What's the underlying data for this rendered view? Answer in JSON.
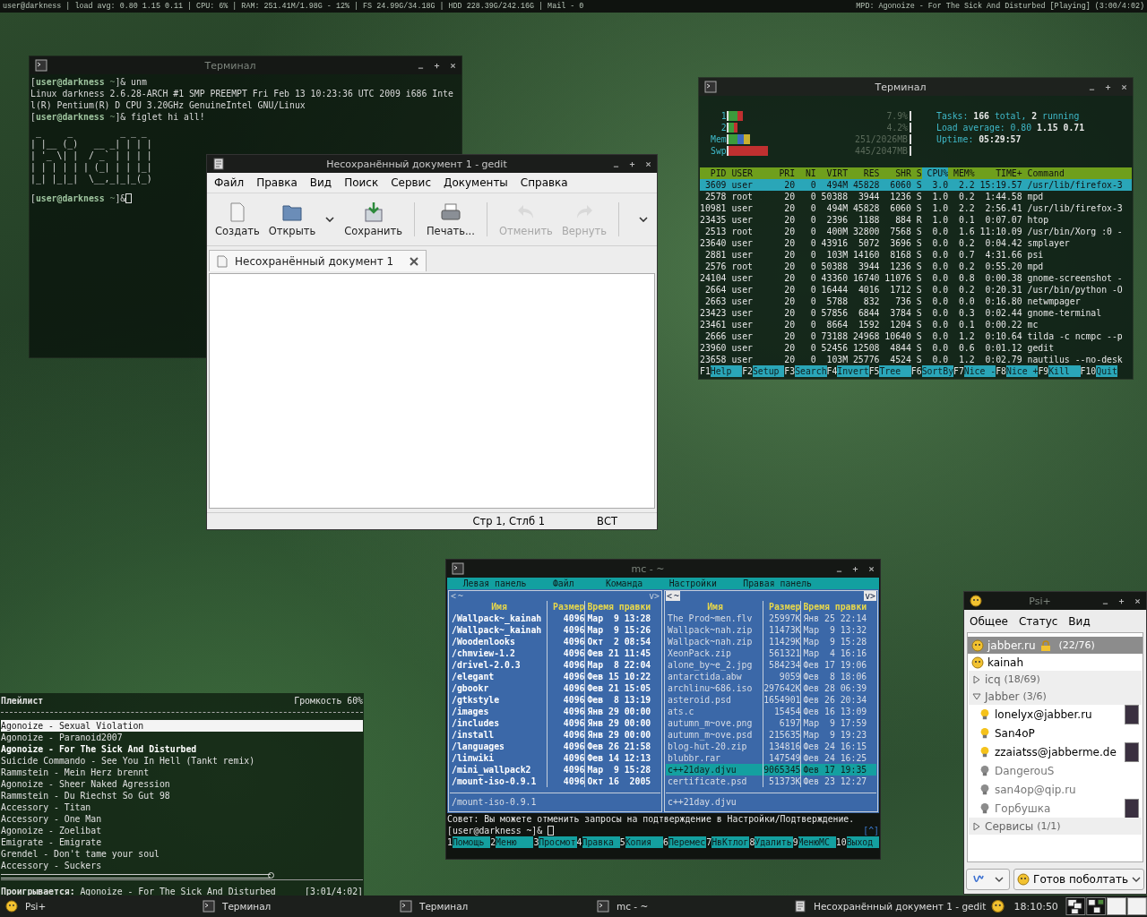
{
  "top_bar": {
    "left": "user@darkness | load avg: 0.80 1.15 0.11 | CPU: 6% | RAM: 251.41M/1.98G - 12% | FS 24.99G/34.18G | HDD 228.39G/242.16G | Mail - 0",
    "right": "MPD: Agonoize - For The Sick And Disturbed [Playing] (3:00/4:02)"
  },
  "gedit": {
    "title": "Несохранённый документ 1 - gedit",
    "menu": [
      "Файл",
      "Правка",
      "Вид",
      "Поиск",
      "Сервис",
      "Документы",
      "Справка"
    ],
    "toolbar": [
      {
        "kind": "button",
        "label": "Создать",
        "disabled": false
      },
      {
        "kind": "button",
        "label": "Открыть",
        "disabled": false
      },
      {
        "kind": "dropdown"
      },
      {
        "kind": "button",
        "label": "Сохранить",
        "disabled": false
      },
      {
        "kind": "separator"
      },
      {
        "kind": "button",
        "label": "Печать...",
        "disabled": false
      },
      {
        "kind": "separator"
      },
      {
        "kind": "button",
        "label": "Отменить",
        "disabled": true
      },
      {
        "kind": "button",
        "label": "Вернуть",
        "disabled": true
      },
      {
        "kind": "separator"
      },
      {
        "kind": "overflow"
      }
    ],
    "tabs": [
      {
        "label": "Несохранённый документ 1",
        "selected": true
      }
    ],
    "status": {
      "position": "Стр 1, Стлб 1",
      "mode": "ВСТ"
    }
  },
  "terminal": {
    "title": "Терминал",
    "lines": [
      {
        "kind": "prompt",
        "cursor": false,
        "segments": [
          "[",
          "user@darkness",
          " ~",
          "]& unm"
        ]
      },
      {
        "kind": "output",
        "text": "Linux darkness 2.6.28-ARCH #1 SMP PREEMPT Fri Feb 13 10:23:36 UTC 2009 i686 Inte"
      },
      {
        "kind": "output",
        "text": "l(R) Pentium(R) D CPU 3.20GHz GenuineIntel GNU/Linux"
      },
      {
        "kind": "prompt",
        "cursor": false,
        "segments": [
          "[",
          "user@darkness",
          " ~",
          "]& figlet hi all!"
        ]
      },
      {
        "kind": "art",
        "lines": [
          " _     _         _ _ _ ",
          "| |__ (_)   __ _| | | |",
          "| '_ \\| |  / _` | | | |",
          "| | | | | | (_| | | |_|",
          "|_| |_|_|  \\__,_|_|_(_)"
        ]
      },
      {
        "kind": "prompt",
        "cursor": true,
        "segments": [
          "[",
          "user@darkness",
          " ~",
          "]&"
        ]
      }
    ]
  },
  "htop": {
    "title": "Терминал",
    "meters": [
      {
        "kind": "cpu",
        "label": "1",
        "level": 0.08,
        "reading": "7.9%"
      },
      {
        "kind": "cpu",
        "label": "2",
        "level": 0.05,
        "reading": "4.2%"
      },
      {
        "kind": "mem",
        "label": "Mem",
        "level": 0.12,
        "reading": "251/2026MB"
      },
      {
        "kind": "swap",
        "label": "Swp",
        "level": 0.22,
        "reading": "445/2047MB"
      }
    ],
    "info": [
      "Tasks: **166** total, **2** running",
      "Load average: 0.80 **1.15** **0.71**",
      "Uptime: **05:29:57**"
    ],
    "columns": [
      {
        "label": "PID",
        "sorted": false
      },
      {
        "label": "USER",
        "sorted": false
      },
      {
        "label": "PRI",
        "sorted": false
      },
      {
        "label": "NI",
        "sorted": false
      },
      {
        "label": "VIRT",
        "sorted": false
      },
      {
        "label": "RES",
        "sorted": false
      },
      {
        "label": "SHR",
        "sorted": false
      },
      {
        "label": "S",
        "sorted": false
      },
      {
        "label": "CPU%",
        "sorted": true
      },
      {
        "label": "MEM%",
        "sorted": false
      },
      {
        "label": "TIME+",
        "sorted": false
      },
      {
        "label": "Command",
        "sorted": false
      }
    ],
    "rows": [
      {
        "selected": true,
        "cells": [
          "3609",
          "user",
          "20",
          "0",
          "494M",
          "45828",
          "6060",
          "S",
          "3.0",
          "2.2",
          "15:19.57",
          "/usr/lib/firefox-3"
        ]
      },
      {
        "selected": false,
        "cells": [
          "2578",
          "root",
          "20",
          "0",
          "50388",
          "3944",
          "1236",
          "S",
          "1.0",
          "0.2",
          "1:44.58",
          "mpd"
        ]
      },
      {
        "selected": false,
        "cells": [
          "10981",
          "user",
          "20",
          "0",
          "494M",
          "45828",
          "6060",
          "S",
          "1.0",
          "2.2",
          "2:56.41",
          "/usr/lib/firefox-3"
        ]
      },
      {
        "selected": false,
        "cells": [
          "23435",
          "user",
          "20",
          "0",
          "2396",
          "1188",
          "884",
          "R",
          "1.0",
          "0.1",
          "0:07.07",
          "htop"
        ]
      },
      {
        "selected": false,
        "cells": [
          "2513",
          "root",
          "20",
          "0",
          "400M",
          "32800",
          "7568",
          "S",
          "0.0",
          "1.6",
          "11:10.09",
          "/usr/bin/Xorg :0 -"
        ]
      },
      {
        "selected": false,
        "cells": [
          "23640",
          "user",
          "20",
          "0",
          "43916",
          "5072",
          "3696",
          "S",
          "0.0",
          "0.2",
          "0:04.42",
          "smplayer"
        ]
      },
      {
        "selected": false,
        "cells": [
          "2881",
          "user",
          "20",
          "0",
          "103M",
          "14160",
          "8168",
          "S",
          "0.0",
          "0.7",
          "4:31.66",
          "psi"
        ]
      },
      {
        "selected": false,
        "cells": [
          "2576",
          "root",
          "20",
          "0",
          "50388",
          "3944",
          "1236",
          "S",
          "0.0",
          "0.2",
          "0:55.20",
          "mpd"
        ]
      },
      {
        "selected": false,
        "cells": [
          "24104",
          "user",
          "20",
          "0",
          "43360",
          "16740",
          "11076",
          "S",
          "0.0",
          "0.8",
          "0:00.38",
          "gnome-screenshot -"
        ]
      },
      {
        "selected": false,
        "cells": [
          "2664",
          "user",
          "20",
          "0",
          "16444",
          "4016",
          "1712",
          "S",
          "0.0",
          "0.2",
          "0:20.31",
          "/usr/bin/python -O"
        ]
      },
      {
        "selected": false,
        "cells": [
          "2663",
          "user",
          "20",
          "0",
          "5788",
          "832",
          "736",
          "S",
          "0.0",
          "0.0",
          "0:16.80",
          "netwmpager"
        ]
      },
      {
        "selected": false,
        "cells": [
          "23423",
          "user",
          "20",
          "0",
          "57856",
          "6844",
          "3784",
          "S",
          "0.0",
          "0.3",
          "0:02.44",
          "gnome-terminal"
        ]
      },
      {
        "selected": false,
        "cells": [
          "23461",
          "user",
          "20",
          "0",
          "8664",
          "1592",
          "1204",
          "S",
          "0.0",
          "0.1",
          "0:00.22",
          "mc"
        ]
      },
      {
        "selected": false,
        "cells": [
          "2666",
          "user",
          "20",
          "0",
          "73188",
          "24968",
          "10640",
          "S",
          "0.0",
          "1.2",
          "0:10.64",
          "tilda -c ncmpc --p"
        ]
      },
      {
        "selected": false,
        "cells": [
          "23960",
          "user",
          "20",
          "0",
          "52456",
          "12508",
          "4844",
          "S",
          "0.0",
          "0.6",
          "0:01.12",
          "gedit"
        ]
      },
      {
        "selected": false,
        "cells": [
          "23658",
          "user",
          "20",
          "0",
          "103M",
          "25776",
          "4524",
          "S",
          "0.0",
          "1.2",
          "0:02.79",
          "nautilus --no-desk"
        ]
      }
    ],
    "keys": [
      {
        "key": "F1",
        "label": "Help"
      },
      {
        "key": "F2",
        "label": "Setup"
      },
      {
        "key": "F3",
        "label": "Search"
      },
      {
        "key": "F4",
        "label": "Invert"
      },
      {
        "key": "F5",
        "label": "Tree"
      },
      {
        "key": "F6",
        "label": "SortBy"
      },
      {
        "key": "F7",
        "label": "Nice -"
      },
      {
        "key": "F8",
        "label": "Nice +"
      },
      {
        "key": "F9",
        "label": "Kill"
      },
      {
        "key": "F10",
        "label": "Quit"
      }
    ]
  },
  "mc": {
    "title": "mc - ~",
    "menu": [
      "Левая панель",
      "Файл",
      "Команда",
      "Настройки",
      "Правая панель"
    ],
    "panels": [
      {
        "active": false,
        "corner_left": "<",
        "path": "~",
        "corner_right": "v>",
        "columns": [
          "Имя",
          "Размер",
          "Время правки"
        ],
        "status": "/mount-iso-0.9.1",
        "rows": [
          {
            "kind": "dir",
            "selected": false,
            "cells": [
              "/Wallpack~_kainah",
              "4096",
              "Мар  9 13:28"
            ]
          },
          {
            "kind": "dir",
            "selected": false,
            "cells": [
              "/Wallpack~_kainah",
              "4096",
              "Мар  9 15:26"
            ]
          },
          {
            "kind": "dir",
            "selected": false,
            "cells": [
              "/Woodenlooks",
              "4096",
              "Окт  2 08:54"
            ]
          },
          {
            "kind": "dir",
            "selected": false,
            "cells": [
              "/chmview-1.2",
              "4096",
              "Фев 21 11:45"
            ]
          },
          {
            "kind": "dir",
            "selected": false,
            "cells": [
              "/drivel-2.0.3",
              "4096",
              "Мар  8 22:04"
            ]
          },
          {
            "kind": "dir",
            "selected": false,
            "cells": [
              "/elegant",
              "4096",
              "Фев 15 10:22"
            ]
          },
          {
            "kind": "dir",
            "selected": false,
            "cells": [
              "/gbookr",
              "4096",
              "Фев 21 15:05"
            ]
          },
          {
            "kind": "dir",
            "selected": false,
            "cells": [
              "/gtkstyle",
              "4096",
              "Фев  8 13:19"
            ]
          },
          {
            "kind": "dir",
            "selected": false,
            "cells": [
              "/images",
              "4096",
              "Янв 29 00:00"
            ]
          },
          {
            "kind": "dir",
            "selected": false,
            "cells": [
              "/includes",
              "4096",
              "Янв 29 00:00"
            ]
          },
          {
            "kind": "dir",
            "selected": false,
            "cells": [
              "/install",
              "4096",
              "Янв 29 00:00"
            ]
          },
          {
            "kind": "dir",
            "selected": false,
            "cells": [
              "/languages",
              "4096",
              "Фев 26 21:58"
            ]
          },
          {
            "kind": "dir",
            "selected": false,
            "cells": [
              "/linwiki",
              "4096",
              "Фев 14 12:13"
            ]
          },
          {
            "kind": "dir",
            "selected": false,
            "cells": [
              "/mini_wallpack2",
              "4096",
              "Мар  9 15:28"
            ]
          },
          {
            "kind": "dir",
            "selected": false,
            "cells": [
              "/mount-iso-0.9.1",
              "4096",
              "Окт 16  2005"
            ]
          }
        ]
      },
      {
        "active": true,
        "corner_left": "<",
        "path": "~",
        "corner_right": "v>",
        "columns": [
          "Имя",
          "Размер",
          "Время правки"
        ],
        "status": "c++21day.djvu",
        "rows": [
          {
            "kind": "file",
            "selected": false,
            "cells": [
              "The Prod~men.flv",
              "25997K",
              "Янв 25 22:14"
            ]
          },
          {
            "kind": "file",
            "selected": false,
            "cells": [
              "Wallpack~nah.zip",
              "11473K",
              "Мар  9 13:32"
            ]
          },
          {
            "kind": "file",
            "selected": false,
            "cells": [
              "Wallpack~nah.zip",
              "11429K",
              "Мар  9 15:28"
            ]
          },
          {
            "kind": "file",
            "selected": false,
            "cells": [
              "XeonPack.zip",
              "561321",
              "Мар  4 16:16"
            ]
          },
          {
            "kind": "file",
            "selected": false,
            "cells": [
              "alone_by~e_2.jpg",
              "584234",
              "Фев 17 19:06"
            ]
          },
          {
            "kind": "file",
            "selected": false,
            "cells": [
              "antarctida.abw",
              "9059",
              "Фев  8 18:06"
            ]
          },
          {
            "kind": "file",
            "selected": false,
            "cells": [
              "archlinu~686.iso",
              "297642K",
              "Фев 28 06:39"
            ]
          },
          {
            "kind": "file",
            "selected": false,
            "cells": [
              "asteroid.psd",
              "1654901",
              "Фев 26 20:34"
            ]
          },
          {
            "kind": "file",
            "selected": false,
            "cells": [
              "ats.c",
              "15454",
              "Фев 16 13:09"
            ]
          },
          {
            "kind": "file",
            "selected": false,
            "cells": [
              "autumn_m~ove.png",
              "6197",
              "Мар  9 17:59"
            ]
          },
          {
            "kind": "file",
            "selected": false,
            "cells": [
              "autumn_m~ove.psd",
              "215635",
              "Мар  9 19:23"
            ]
          },
          {
            "kind": "file",
            "selected": false,
            "cells": [
              "blog-hut-20.zip",
              "134816",
              "Фев 24 16:15"
            ]
          },
          {
            "kind": "file",
            "selected": false,
            "cells": [
              "blubbr.rar",
              "147549",
              "Фев 24 16:25"
            ]
          },
          {
            "kind": "file",
            "selected": true,
            "cells": [
              "c++21day.djvu",
              "9065345",
              "Фев 17 19:35"
            ]
          },
          {
            "kind": "file",
            "selected": false,
            "cells": [
              "certificate.psd",
              "51373K",
              "Фев 23 12:27"
            ]
          }
        ]
      }
    ],
    "hint": "Совет: Вы можете отменить запросы на подтверждение в Настройки/Подтверждение.",
    "prompt": "[user@darkness ~]&",
    "scroll_marker": "[^]",
    "keys": [
      {
        "key": "1",
        "label": "Помощь"
      },
      {
        "key": "2",
        "label": "Меню"
      },
      {
        "key": "3",
        "label": "Просмот"
      },
      {
        "key": "4",
        "label": "Правка"
      },
      {
        "key": "5",
        "label": "Копия"
      },
      {
        "key": "6",
        "label": "Перемес"
      },
      {
        "key": "7",
        "label": "НвКтлог"
      },
      {
        "key": "8",
        "label": "Удалить"
      },
      {
        "key": "9",
        "label": "МенюМС"
      },
      {
        "key": "10",
        "label": "Выход"
      }
    ]
  },
  "playlist": {
    "title": "Плейлист",
    "volume": "Громкость 60%",
    "songs": [
      {
        "title": "Agonoize - Sexual Violation",
        "selected": true,
        "playing": false
      },
      {
        "title": "Agonoize - Paranoid2007",
        "selected": false,
        "playing": false
      },
      {
        "title": "Agonoize - For The Sick And Disturbed",
        "selected": false,
        "playing": true
      },
      {
        "title": "Suicide Commando - See You In Hell (Tankt remix)",
        "selected": false,
        "playing": false
      },
      {
        "title": "Rammstein - Mein Herz brennt",
        "selected": false,
        "playing": false
      },
      {
        "title": "Agonoize - Sheer Naked Agression",
        "selected": false,
        "playing": false
      },
      {
        "title": "Rammstein - Du Riechst So Gut 98",
        "selected": false,
        "playing": false
      },
      {
        "title": "Accessory - Titan",
        "selected": false,
        "playing": false
      },
      {
        "title": "Accessory - One Man",
        "selected": false,
        "playing": false
      },
      {
        "title": "Agonoize - Zoelibat",
        "selected": false,
        "playing": false
      },
      {
        "title": "Emigrate - Emigrate",
        "selected": false,
        "playing": false
      },
      {
        "title": "Grendel - Don't tame your soul",
        "selected": false,
        "playing": false
      },
      {
        "title": "Accessory - Suckers",
        "selected": false,
        "playing": false
      }
    ],
    "progress": {
      "level": 0.745
    },
    "now_playing": "**Проигрывается:** Agonoize - For The Sick And Disturbed",
    "time": "[3:01/4:02]"
  },
  "psi": {
    "title": "Psi+",
    "menu": [
      "Общее",
      "Статус",
      "Вид"
    ],
    "roster": [
      {
        "kind": "account",
        "name": "jabber.ru",
        "locked": true,
        "count": "(22/76)",
        "selected": true
      },
      {
        "kind": "self",
        "name": "kainah",
        "selected": false
      },
      {
        "kind": "group",
        "name": "icq",
        "count": "(18/69)",
        "expanded": false,
        "selected": false
      },
      {
        "kind": "group",
        "name": "Jabber",
        "count": "(3/6)",
        "expanded": true,
        "selected": false,
        "children": [
          {
            "name": "lonelyx@jabber.ru",
            "online": true,
            "avatar": true,
            "selected": false
          },
          {
            "name": "San4oP",
            "online": true,
            "avatar": false,
            "selected": false
          },
          {
            "name": "zzaiatss@jabberme.de",
            "online": true,
            "avatar": true,
            "selected": false
          },
          {
            "name": "DangerouS",
            "online": false,
            "avatar": false,
            "selected": false
          },
          {
            "name": "san4op@qip.ru",
            "online": false,
            "avatar": false,
            "selected": false
          },
          {
            "name": "Горбушка",
            "online": false,
            "avatar": true,
            "selected": false
          }
        ]
      },
      {
        "kind": "group",
        "name": "Сервисы",
        "count": "(1/1)",
        "expanded": false,
        "selected": false
      }
    ],
    "status_button": "Готов поболтать"
  },
  "taskbar": {
    "items": [
      {
        "kind": "psi",
        "label": "Psi+"
      },
      {
        "kind": "terminal",
        "label": "Терминал"
      },
      {
        "kind": "terminal",
        "label": "Терминал"
      },
      {
        "kind": "terminal",
        "label": "mc - ~"
      },
      {
        "kind": "editor",
        "label": "Несохранённый документ 1 - gedit"
      }
    ],
    "clock": "18:10:50"
  }
}
